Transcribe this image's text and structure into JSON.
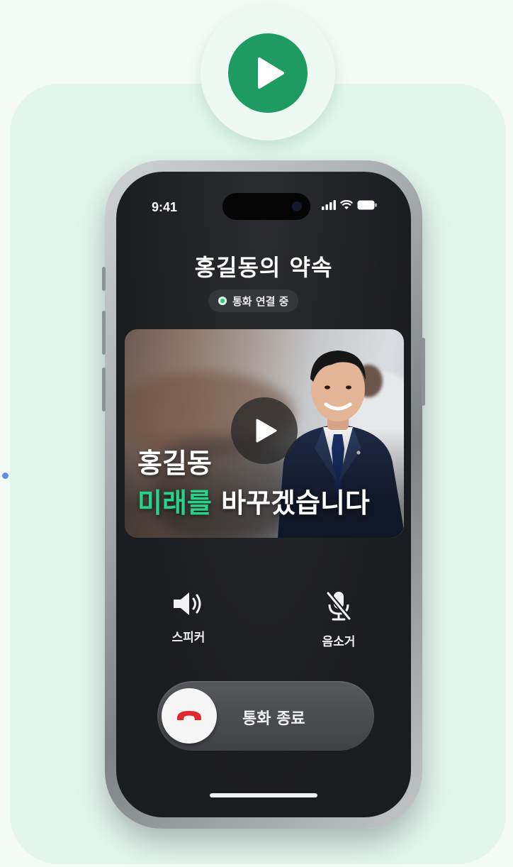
{
  "status_bar": {
    "time": "9:41"
  },
  "call": {
    "title": "홍길동의 약속",
    "status": "통화 연결 중"
  },
  "video": {
    "headline_line1": "홍길동",
    "headline_highlight": "미래를",
    "headline_rest": " 바꾸겠습니다"
  },
  "controls": {
    "speaker_label": "스피커",
    "mute_label": "음소거",
    "end_call_label": "통화 종료"
  },
  "colors": {
    "accent_green": "#1e9b61",
    "highlight_green": "#27d38a",
    "end_call_red": "#e0282e"
  },
  "icons": {
    "top": "play-icon",
    "video": "play-icon",
    "speaker": "speaker-icon",
    "mute": "microphone-off-icon",
    "end": "phone-hangup-icon"
  }
}
